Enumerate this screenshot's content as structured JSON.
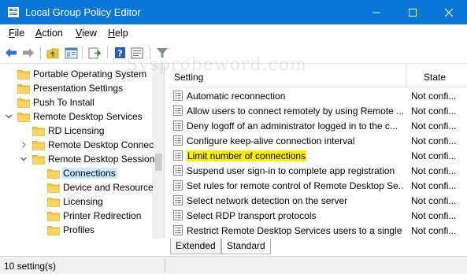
{
  "window": {
    "title": "Local Group Policy Editor",
    "titlebar_color": "#0a77d8"
  },
  "menu": [
    {
      "label_mnemonic": "F",
      "label_rest": "ile"
    },
    {
      "label_mnemonic": "A",
      "label_rest": "ction"
    },
    {
      "label_mnemonic": "V",
      "label_rest": "iew"
    },
    {
      "label_mnemonic": "H",
      "label_rest": "elp"
    }
  ],
  "toolbar": {
    "icons": [
      "back-arrow-icon",
      "forward-arrow-icon",
      "up-folder-icon",
      "show-hide-tree-icon",
      "export-list-icon",
      "help-icon",
      "properties-icon",
      "filter-icon"
    ]
  },
  "tree": {
    "items": [
      {
        "label": "Portable Operating System",
        "expander": "none"
      },
      {
        "label": "Presentation Settings",
        "expander": "none"
      },
      {
        "label": "Push To Install",
        "expander": "none"
      },
      {
        "label": "Remote Desktop Services",
        "expander": "expanded"
      },
      {
        "label": "RD Licensing",
        "expander": "none"
      },
      {
        "label": "Remote Desktop Connec",
        "expander": "collapsed"
      },
      {
        "label": "Remote Desktop Session",
        "expander": "expanded"
      },
      {
        "label": "Connections",
        "expander": "none",
        "selected": true
      },
      {
        "label": "Device and Resource",
        "expander": "none"
      },
      {
        "label": "Licensing",
        "expander": "none"
      },
      {
        "label": "Printer Redirection",
        "expander": "none"
      },
      {
        "label": "Profiles",
        "expander": "none"
      }
    ]
  },
  "list": {
    "col_setting": "Setting",
    "col_state": "State",
    "rows": [
      {
        "name": "Automatic reconnection",
        "state": "Not confi..."
      },
      {
        "name": "Allow users to connect remotely by using Remote ...",
        "state": "Not confi..."
      },
      {
        "name": "Deny logoff of an administrator logged in to the c...",
        "state": "Not confi..."
      },
      {
        "name": "Configure keep-alive connection interval",
        "state": "Not confi..."
      },
      {
        "name": "Limit number of connections",
        "state": "Not confi...",
        "highlighted": true
      },
      {
        "name": "Suspend user sign-in to complete app registration",
        "state": "Not confi..."
      },
      {
        "name": "Set rules for remote control of Remote Desktop Se...",
        "state": "Not confi..."
      },
      {
        "name": "Select network detection on the server",
        "state": "Not confi..."
      },
      {
        "name": "Select RDP transport protocols",
        "state": "Not confi..."
      },
      {
        "name": "Restrict Remote Desktop Services users to a single ...",
        "state": "Not confi..."
      }
    ]
  },
  "tabs": {
    "extended": "Extended",
    "standard": "Standard"
  },
  "status": {
    "text": "10 setting(s)"
  },
  "watermark": "Sysprobeword.com",
  "colors": {
    "highlight": "#ffee00",
    "selection": "#cce8ff",
    "folder": "#f5c440"
  }
}
